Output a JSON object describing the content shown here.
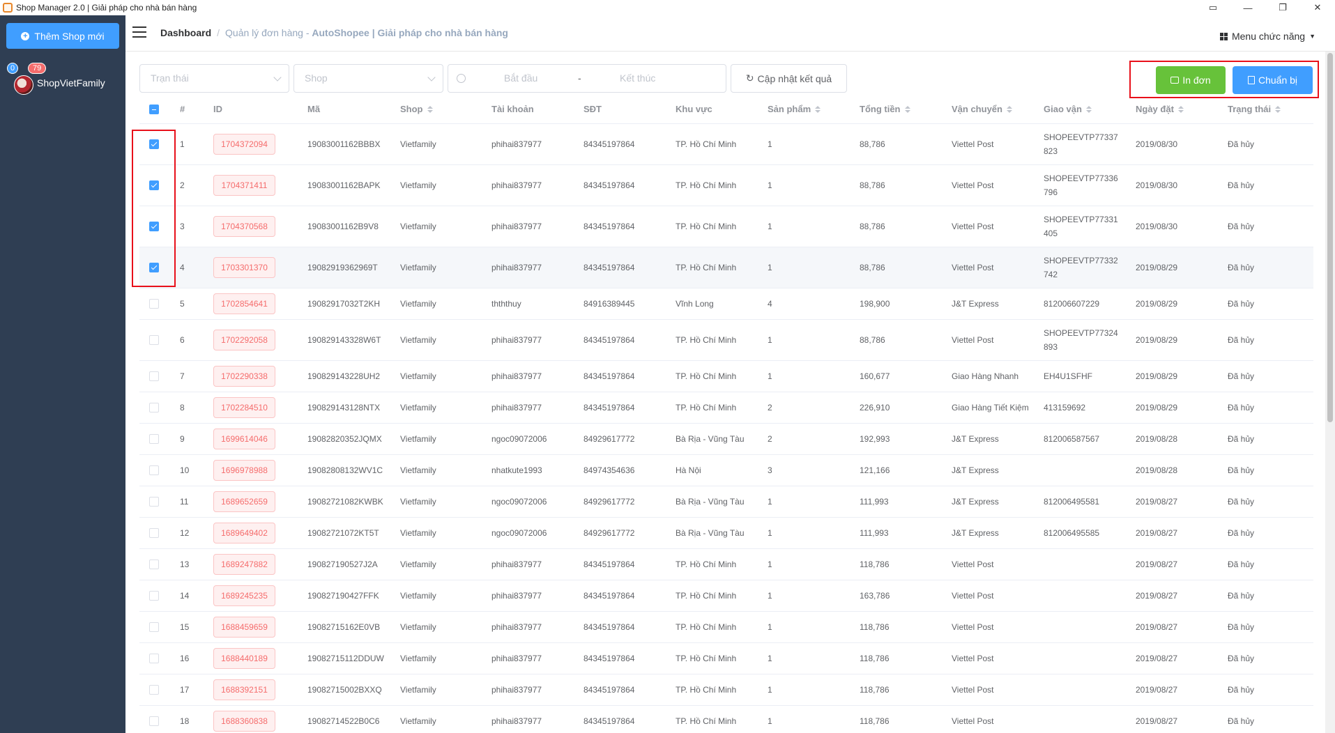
{
  "window": {
    "title": "Shop Manager 2.0 | Giải pháp cho nhà bán hàng"
  },
  "sidebar": {
    "add_shop_label": "Thêm Shop mới",
    "shops": [
      {
        "name": "ShopVietFamily",
        "badge_blue": "0",
        "badge_red": "79"
      }
    ]
  },
  "header": {
    "breadcrumb_home": "Dashboard",
    "breadcrumb_sep": "/",
    "breadcrumb_current": "Quản lý đơn hàng - ",
    "breadcrumb_brand": "AutoShopee | Giải pháp cho nhà bán hàng",
    "menu_label": "Menu chức năng"
  },
  "filters": {
    "status_placeholder": "Trạn thái",
    "shop_placeholder": "Shop",
    "start_placeholder": "Bắt đầu",
    "range_separator": "-",
    "end_placeholder": "Kết thúc",
    "refresh_label": "Cập nhật kết quả"
  },
  "actions": {
    "print_label": "In đơn",
    "prepare_label": "Chuẩn bị"
  },
  "table": {
    "columns": [
      "#",
      "ID",
      "Mã",
      "Shop",
      "Tài khoản",
      "SĐT",
      "Khu vực",
      "Sản phẩm",
      "Tổng tiền",
      "Vận chuyển",
      "Giao vận",
      "Ngày đặt",
      "Trạng thái"
    ],
    "rows": [
      {
        "checked": true,
        "no": "1",
        "id": "1704372094",
        "code": "19083001162BBBX",
        "shop": "Vietfamily",
        "account": "phihai837977",
        "phone": "84345197864",
        "area": "TP. Hồ Chí Minh",
        "qty": "1",
        "total": "88,786",
        "carrier": "Viettel Post",
        "tracking": "SHOPEEVTP77337823",
        "tracking_1": "SHOPEEVTP77337",
        "tracking_2": "823",
        "date": "2019/08/30",
        "status": "Đã hủy"
      },
      {
        "checked": true,
        "no": "2",
        "id": "1704371411",
        "code": "19083001162BAPK",
        "shop": "Vietfamily",
        "account": "phihai837977",
        "phone": "84345197864",
        "area": "TP. Hồ Chí Minh",
        "qty": "1",
        "total": "88,786",
        "carrier": "Viettel Post",
        "tracking_1": "SHOPEEVTP77336",
        "tracking_2": "796",
        "date": "2019/08/30",
        "status": "Đã hủy"
      },
      {
        "checked": true,
        "no": "3",
        "id": "1704370568",
        "code": "19083001162B9V8",
        "shop": "Vietfamily",
        "account": "phihai837977",
        "phone": "84345197864",
        "area": "TP. Hồ Chí Minh",
        "qty": "1",
        "total": "88,786",
        "carrier": "Viettel Post",
        "tracking_1": "SHOPEEVTP77331",
        "tracking_2": "405",
        "date": "2019/08/30",
        "status": "Đã hủy"
      },
      {
        "checked": true,
        "no": "4",
        "id": "1703301370",
        "code": "19082919362969T",
        "shop": "Vietfamily",
        "account": "phihai837977",
        "phone": "84345197864",
        "area": "TP. Hồ Chí Minh",
        "qty": "1",
        "total": "88,786",
        "carrier": "Viettel Post",
        "tracking_1": "SHOPEEVTP77332",
        "tracking_2": "742",
        "date": "2019/08/29",
        "status": "Đã hủy"
      },
      {
        "checked": false,
        "no": "5",
        "id": "1702854641",
        "code": "19082917032T2KH",
        "shop": "Vietfamily",
        "account": "thththuy",
        "phone": "84916389445",
        "area": "Vĩnh Long",
        "qty": "4",
        "total": "198,900",
        "carrier": "J&T Express",
        "tracking_1": "812006607229",
        "tracking_2": "",
        "date": "2019/08/29",
        "status": "Đã hủy"
      },
      {
        "checked": false,
        "no": "6",
        "id": "1702292058",
        "code": "190829143328W6T",
        "shop": "Vietfamily",
        "account": "phihai837977",
        "phone": "84345197864",
        "area": "TP. Hồ Chí Minh",
        "qty": "1",
        "total": "88,786",
        "carrier": "Viettel Post",
        "tracking_1": "SHOPEEVTP77324",
        "tracking_2": "893",
        "date": "2019/08/29",
        "status": "Đã hủy"
      },
      {
        "checked": false,
        "no": "7",
        "id": "1702290338",
        "code": "190829143228UH2",
        "shop": "Vietfamily",
        "account": "phihai837977",
        "phone": "84345197864",
        "area": "TP. Hồ Chí Minh",
        "qty": "1",
        "total": "160,677",
        "carrier": "Giao Hàng Nhanh",
        "tracking_1": "EH4U1SFHF",
        "tracking_2": "",
        "date": "2019/08/29",
        "status": "Đã hủy"
      },
      {
        "checked": false,
        "no": "8",
        "id": "1702284510",
        "code": "190829143128NTX",
        "shop": "Vietfamily",
        "account": "phihai837977",
        "phone": "84345197864",
        "area": "TP. Hồ Chí Minh",
        "qty": "2",
        "total": "226,910",
        "carrier": "Giao Hàng Tiết Kiệm",
        "tracking_1": "413159692",
        "tracking_2": "",
        "date": "2019/08/29",
        "status": "Đã hủy"
      },
      {
        "checked": false,
        "no": "9",
        "id": "1699614046",
        "code": "19082820352JQMX",
        "shop": "Vietfamily",
        "account": "ngoc09072006",
        "phone": "84929617772",
        "area": "Bà Rịa - Vũng Tàu",
        "qty": "2",
        "total": "192,993",
        "carrier": "J&T Express",
        "tracking_1": "812006587567",
        "tracking_2": "",
        "date": "2019/08/28",
        "status": "Đã hủy"
      },
      {
        "checked": false,
        "no": "10",
        "id": "1696978988",
        "code": "19082808132WV1C",
        "shop": "Vietfamily",
        "account": "nhatkute1993",
        "phone": "84974354636",
        "area": "Hà Nội",
        "qty": "3",
        "total": "121,166",
        "carrier": "J&T Express",
        "tracking_1": "",
        "tracking_2": "",
        "date": "2019/08/28",
        "status": "Đã hủy"
      },
      {
        "checked": false,
        "no": "11",
        "id": "1689652659",
        "code": "19082721082KWBK",
        "shop": "Vietfamily",
        "account": "ngoc09072006",
        "phone": "84929617772",
        "area": "Bà Rịa - Vũng Tàu",
        "qty": "1",
        "total": "111,993",
        "carrier": "J&T Express",
        "tracking_1": "812006495581",
        "tracking_2": "",
        "date": "2019/08/27",
        "status": "Đã hủy"
      },
      {
        "checked": false,
        "no": "12",
        "id": "1689649402",
        "code": "19082721072KT5T",
        "shop": "Vietfamily",
        "account": "ngoc09072006",
        "phone": "84929617772",
        "area": "Bà Rịa - Vũng Tàu",
        "qty": "1",
        "total": "111,993",
        "carrier": "J&T Express",
        "tracking_1": "812006495585",
        "tracking_2": "",
        "date": "2019/08/27",
        "status": "Đã hủy"
      },
      {
        "checked": false,
        "no": "13",
        "id": "1689247882",
        "code": "190827190527J2A",
        "shop": "Vietfamily",
        "account": "phihai837977",
        "phone": "84345197864",
        "area": "TP. Hồ Chí Minh",
        "qty": "1",
        "total": "118,786",
        "carrier": "Viettel Post",
        "tracking_1": "",
        "tracking_2": "",
        "date": "2019/08/27",
        "status": "Đã hủy"
      },
      {
        "checked": false,
        "no": "14",
        "id": "1689245235",
        "code": "190827190427FFK",
        "shop": "Vietfamily",
        "account": "phihai837977",
        "phone": "84345197864",
        "area": "TP. Hồ Chí Minh",
        "qty": "1",
        "total": "163,786",
        "carrier": "Viettel Post",
        "tracking_1": "",
        "tracking_2": "",
        "date": "2019/08/27",
        "status": "Đã hủy"
      },
      {
        "checked": false,
        "no": "15",
        "id": "1688459659",
        "code": "19082715162E0VB",
        "shop": "Vietfamily",
        "account": "phihai837977",
        "phone": "84345197864",
        "area": "TP. Hồ Chí Minh",
        "qty": "1",
        "total": "118,786",
        "carrier": "Viettel Post",
        "tracking_1": "",
        "tracking_2": "",
        "date": "2019/08/27",
        "status": "Đã hủy"
      },
      {
        "checked": false,
        "no": "16",
        "id": "1688440189",
        "code": "19082715112DDUW",
        "shop": "Vietfamily",
        "account": "phihai837977",
        "phone": "84345197864",
        "area": "TP. Hồ Chí Minh",
        "qty": "1",
        "total": "118,786",
        "carrier": "Viettel Post",
        "tracking_1": "",
        "tracking_2": "",
        "date": "2019/08/27",
        "status": "Đã hủy"
      },
      {
        "checked": false,
        "no": "17",
        "id": "1688392151",
        "code": "19082715002BXXQ",
        "shop": "Vietfamily",
        "account": "phihai837977",
        "phone": "84345197864",
        "area": "TP. Hồ Chí Minh",
        "qty": "1",
        "total": "118,786",
        "carrier": "Viettel Post",
        "tracking_1": "",
        "tracking_2": "",
        "date": "2019/08/27",
        "status": "Đã hủy"
      },
      {
        "checked": false,
        "no": "18",
        "id": "1688360838",
        "code": "19082714522B0C6",
        "shop": "Vietfamily",
        "account": "phihai837977",
        "phone": "84345197864",
        "area": "TP. Hồ Chí Minh",
        "qty": "1",
        "total": "118,786",
        "carrier": "Viettel Post",
        "tracking_1": "",
        "tracking_2": "",
        "date": "2019/08/27",
        "status": "Đã hủy"
      }
    ]
  }
}
